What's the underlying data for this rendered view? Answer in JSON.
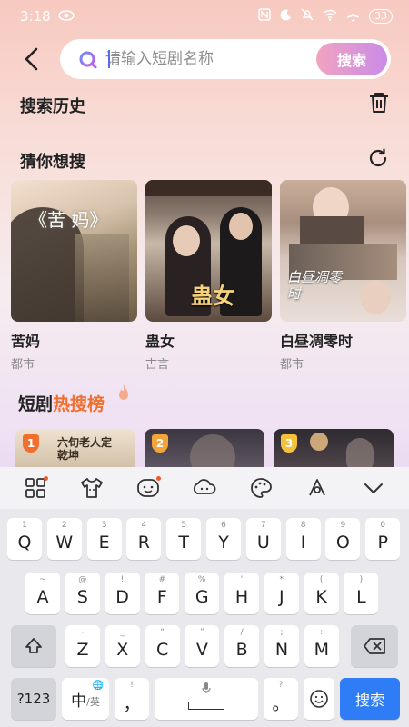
{
  "status_bar": {
    "time": "3:18",
    "battery": "33"
  },
  "search": {
    "placeholder": "请输入短剧名称",
    "button_label": "搜索"
  },
  "history": {
    "title": "搜索历史"
  },
  "guess": {
    "title": "猜你想搜",
    "items": [
      {
        "title": "苦妈",
        "tag": "都市",
        "poster_text": "《苦 妈》"
      },
      {
        "title": "蛊女",
        "tag": "古言",
        "poster_text": "蛊女"
      },
      {
        "title": "白昼凋零时",
        "tag": "都市",
        "poster_text": "白昼凋零时"
      }
    ]
  },
  "hot": {
    "title_prefix": "短剧",
    "title_accent": "热搜榜",
    "items": [
      {
        "rank": "1",
        "poster_text": "六旬老人定乾坤",
        "badge_color": "#f06f2e"
      },
      {
        "rank": "2",
        "poster_text": "",
        "badge_color": "#f3a43a"
      },
      {
        "rank": "3",
        "poster_text": "",
        "badge_color": "#f3c23a"
      }
    ]
  },
  "keyboard": {
    "row1": [
      {
        "k": "Q",
        "s": "1"
      },
      {
        "k": "W",
        "s": "2"
      },
      {
        "k": "E",
        "s": "3"
      },
      {
        "k": "R",
        "s": "4"
      },
      {
        "k": "T",
        "s": "5"
      },
      {
        "k": "Y",
        "s": "6"
      },
      {
        "k": "U",
        "s": "7"
      },
      {
        "k": "I",
        "s": "8"
      },
      {
        "k": "O",
        "s": "9"
      },
      {
        "k": "P",
        "s": "0"
      }
    ],
    "row2": [
      {
        "k": "A",
        "s": "~"
      },
      {
        "k": "S",
        "s": "@"
      },
      {
        "k": "D",
        "s": "!"
      },
      {
        "k": "F",
        "s": "#"
      },
      {
        "k": "G",
        "s": "%"
      },
      {
        "k": "H",
        "s": "'"
      },
      {
        "k": "J",
        "s": "*"
      },
      {
        "k": "K",
        "s": "("
      },
      {
        "k": "L",
        "s": ")"
      }
    ],
    "row3": [
      {
        "k": "Z",
        "s": "-"
      },
      {
        "k": "X",
        "s": "_"
      },
      {
        "k": "C",
        "s": "“"
      },
      {
        "k": "V",
        "s": "”"
      },
      {
        "k": "B",
        "s": "/"
      },
      {
        "k": "N",
        "s": ";"
      },
      {
        "k": "M",
        "s": ":"
      }
    ],
    "num_key": "?123",
    "lang_key": "中",
    "lang_sub": "/英",
    "comma_key": "，",
    "comma_sub": "!",
    "period_key": "。",
    "period_sub": "?",
    "enter_key": "搜索"
  }
}
